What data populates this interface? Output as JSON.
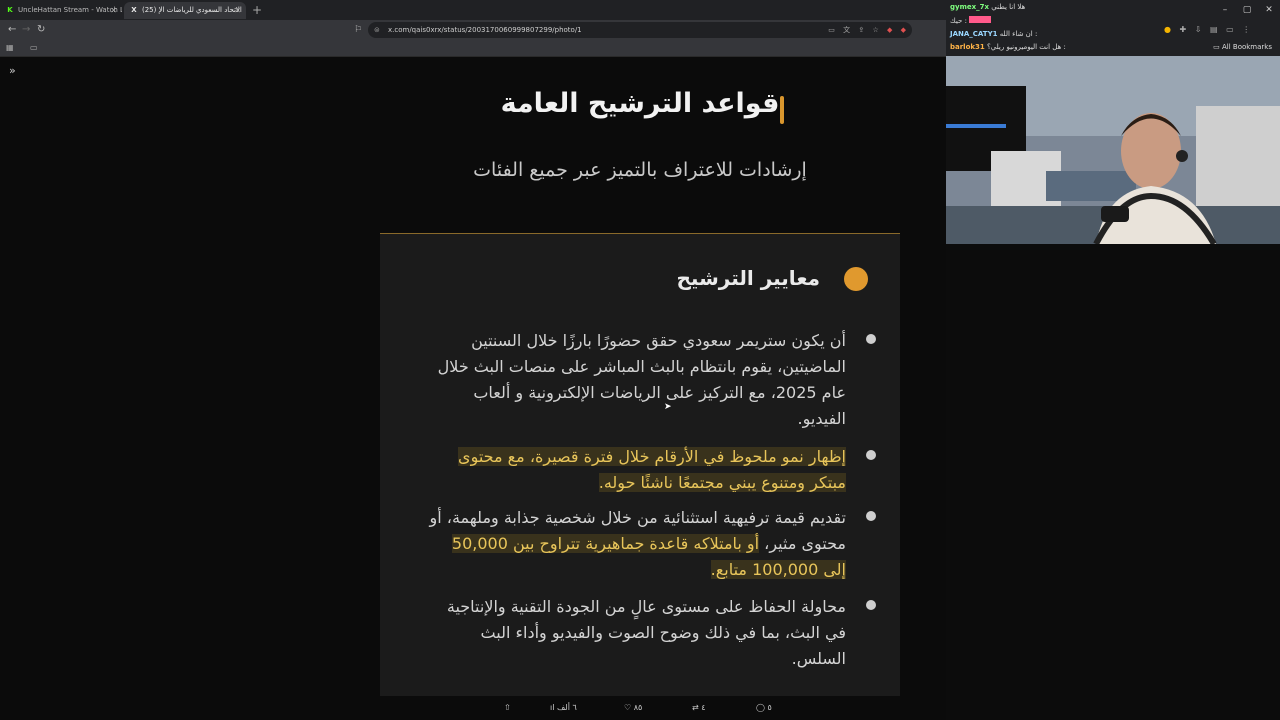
{
  "browser": {
    "tabs": [
      {
        "favicon": "K",
        "label": "UncleHattan Stream - Watch Live on"
      },
      {
        "favicon": "X",
        "label": "(25) الاتحاد السعودي للرياضات الإ",
        "active": true
      }
    ],
    "new_tab_icon": "+",
    "url": "x.com/qais0xrx/status/2003170060999807299/photo/1",
    "window_buttons": [
      "–",
      "▢",
      "✕"
    ],
    "all_bookmarks": "All Bookmarks"
  },
  "article": {
    "title": "قواعد الترشيح العامة",
    "subtitle": "إرشادات للاعتراف بالتميز عبر جميع الفئات",
    "card_title": "معايير الترشيح",
    "items": [
      {
        "text": "أن يكون ستريمر سعودي حقق حضورًا بارزًا خلال السنتين الماضيتين، يقوم بانتظام بالبث المباشر على منصات البث خلال عام 2025، مع التركيز على الرياضات الإلكترونية و ألعاب الفيديو."
      },
      {
        "text": "إظهار نمو ملحوظ في الأرقام خلال فترة قصيرة، مع محتوى مبتكر ومتنوع يبني مجتمعًا ناشئًا حوله."
      },
      {
        "text_plain": "تقديم قيمة ترفيهية استثنائية من خلال شخصية جذابة وملهمة، أو محتوى مثير، ",
        "text_highlight": "أو بامتلاكه قاعدة جماهيرية تتراوح بين 50,000 إلى 100,000 متابع."
      },
      {
        "text": "محاولة الحفاظ على مستوى عالٍ من الجودة التقنية والإنتاجية في البث، بما في ذلك وضوح الصوت والفيديو وأداء البث السلس."
      }
    ],
    "actions": {
      "views": "٦ ألف",
      "likes": "٨٥",
      "reposts": "٤",
      "replies": "٥"
    }
  },
  "chat": [
    {
      "user": "gymex_7x",
      "message": "هلا انا يطني",
      "color": "#7fff7f"
    },
    {
      "user": "",
      "message": ": حيك",
      "color": "#ff5a8a"
    },
    {
      "user": "JANA_CATY1",
      "message": "ان شاء الله :",
      "color": "#9ad7ff"
    },
    {
      "user": "barlok31",
      "message": "هل انت اليوميرونيو ريلي؟ :",
      "color": "#ffb347"
    }
  ],
  "icons": {
    "back": "back-arrow-icon",
    "forward": "forward-arrow-icon",
    "reload": "reload-icon",
    "bookmark": "bookmark-star-icon",
    "expand": "expand-panel-icon"
  }
}
